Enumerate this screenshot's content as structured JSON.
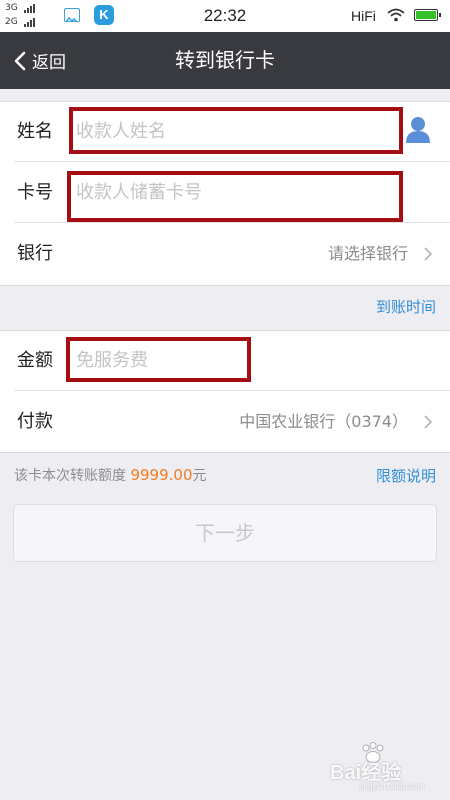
{
  "status_bar": {
    "signal_1": "3G",
    "signal_2": "2G",
    "time": "22:32",
    "hifi": "HiFi",
    "app_icon_letter": "K",
    "battery_level": 1.0
  },
  "nav": {
    "back_label": "返回",
    "title": "转到银行卡"
  },
  "form": {
    "name": {
      "label": "姓名",
      "placeholder": "收款人姓名",
      "value": ""
    },
    "card": {
      "label": "卡号",
      "placeholder": "收款人储蓄卡号",
      "value": ""
    },
    "bank": {
      "label": "银行",
      "value": "请选择银行"
    },
    "arrival_time_link": "到账时间",
    "amount": {
      "label": "金额",
      "placeholder": "免服务费",
      "value": ""
    },
    "payment": {
      "label": "付款",
      "value": "中国农业银行（0374）"
    }
  },
  "limit": {
    "prefix": "该卡本次转账额度",
    "amount": "9999.00",
    "suffix": "元",
    "link": "限额说明"
  },
  "next_button": "下一步",
  "watermark": {
    "text": "Bai经验",
    "sub": "jingyan.baidu.com"
  },
  "colors": {
    "nav_bg": "#393a3f",
    "highlight_box": "#a50d15",
    "link": "#2f8fd8",
    "amount_accent": "#f57b1f"
  },
  "icons": [
    "chevron-left-icon",
    "contact-icon",
    "chevron-right-icon",
    "wifi-icon",
    "battery-icon",
    "gallery-icon"
  ]
}
